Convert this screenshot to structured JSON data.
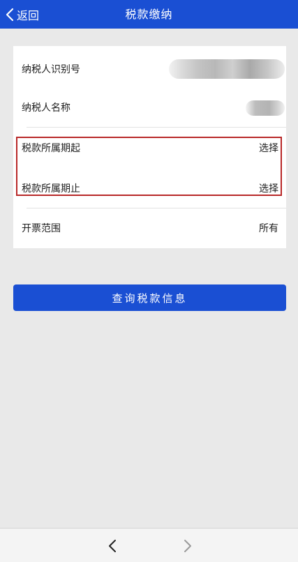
{
  "header": {
    "back_label": "返回",
    "title": "税款缴纳",
    "bg_color": "#1a4fd3"
  },
  "form": {
    "rows": [
      {
        "label": "纳税人识别号",
        "value": ""
      },
      {
        "label": "纳税人名称",
        "value": ""
      },
      {
        "label": "税款所属期起",
        "value": "选择"
      },
      {
        "label": "税款所属期止",
        "value": "选择"
      },
      {
        "label": "开票范围",
        "value": "所有"
      }
    ],
    "highlight_color": "#b82828"
  },
  "query_button": {
    "label": "查询税款信息"
  },
  "bottom_nav": {
    "back_icon": "chevron-left-icon",
    "forward_icon": "chevron-right-icon"
  }
}
